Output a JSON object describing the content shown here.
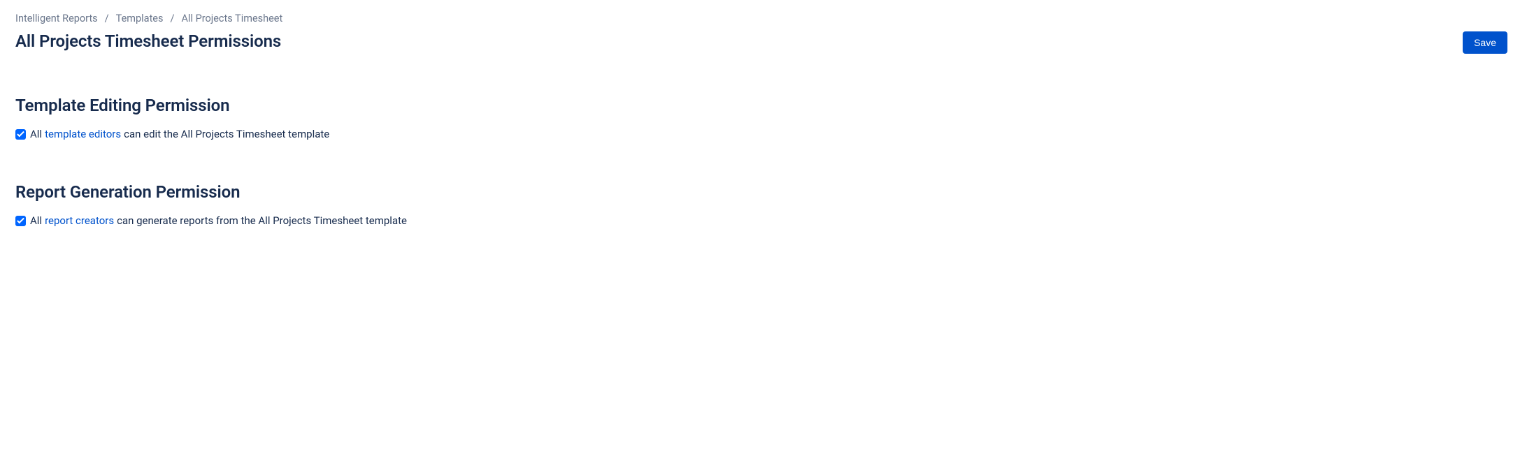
{
  "breadcrumb": {
    "items": [
      "Intelligent Reports",
      "Templates",
      "All Projects Timesheet"
    ],
    "separator": "/"
  },
  "header": {
    "title": "All Projects Timesheet Permissions",
    "save_label": "Save"
  },
  "sections": {
    "template_editing": {
      "title": "Template Editing Permission",
      "checkbox_checked": true,
      "text_prefix": "All ",
      "link_text": "template editors",
      "text_suffix": " can edit the All Projects Timesheet template"
    },
    "report_generation": {
      "title": "Report Generation Permission",
      "checkbox_checked": true,
      "text_prefix": "All ",
      "link_text": "report creators",
      "text_suffix": " can generate reports from the All Projects Timesheet template"
    }
  }
}
